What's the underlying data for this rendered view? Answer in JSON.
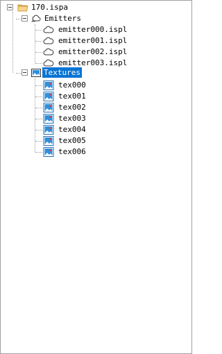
{
  "tree": {
    "root": {
      "label": "170.ispa",
      "icon": "open-folder-icon",
      "expanded": true
    },
    "emitters": {
      "label": "Emitters",
      "icon": "emitters-group-icon",
      "expanded": true,
      "items": [
        "emitter000.ispl",
        "emitter001.ispl",
        "emitter002.ispl",
        "emitter003.ispl"
      ],
      "item_icon": "cloud-icon"
    },
    "textures": {
      "label": "Textures",
      "icon": "image-folder-icon",
      "expanded": true,
      "selected": true,
      "items": [
        "tex000",
        "tex001",
        "tex002",
        "tex003",
        "tex004",
        "tex005",
        "tex006"
      ],
      "item_icon": "image-icon"
    }
  },
  "colors": {
    "selection": "#0a74d4",
    "folder": "#f2c46d",
    "image_sky": "#2f8fdc"
  }
}
